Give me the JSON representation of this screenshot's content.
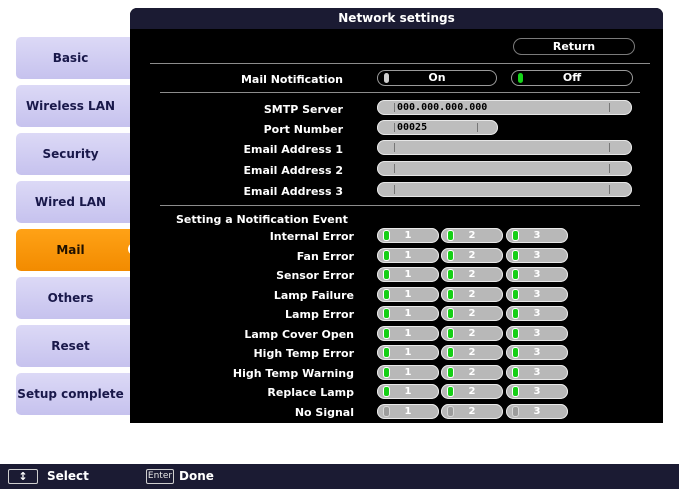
{
  "window": {
    "title": "Network settings"
  },
  "sidebar": {
    "items": [
      {
        "label": "Basic"
      },
      {
        "label": "Wireless LAN"
      },
      {
        "label": "Security"
      },
      {
        "label": "Wired LAN"
      },
      {
        "label": "Mail",
        "active": true
      },
      {
        "label": "Others"
      },
      {
        "label": "Reset"
      },
      {
        "label": "Setup complete"
      }
    ],
    "active_color": "#f28b00",
    "inactive_color": "#d0cdf2"
  },
  "return_label": "Return",
  "mail_notification": {
    "label": "Mail Notification",
    "on_label": "On",
    "off_label": "Off",
    "selected": "Off"
  },
  "smtp": {
    "server_label": "SMTP Server",
    "server_value": "000.000.000.000",
    "port_label": "Port Number",
    "port_value": "00025"
  },
  "email": {
    "address1_label": "Email Address 1",
    "address1_value": "",
    "address2_label": "Email Address 2",
    "address2_value": "",
    "address3_label": "Email Address 3",
    "address3_value": ""
  },
  "events": {
    "heading": "Setting a Notification Event",
    "slot_labels": [
      "1",
      "2",
      "3"
    ],
    "rows": [
      {
        "label": "Internal Error",
        "checked": [
          true,
          true,
          true
        ]
      },
      {
        "label": "Fan Error",
        "checked": [
          true,
          true,
          true
        ]
      },
      {
        "label": "Sensor Error",
        "checked": [
          true,
          true,
          true
        ]
      },
      {
        "label": "Lamp Failure",
        "checked": [
          true,
          true,
          true
        ]
      },
      {
        "label": "Lamp Error",
        "checked": [
          true,
          true,
          true
        ]
      },
      {
        "label": "Lamp Cover Open",
        "checked": [
          true,
          true,
          true
        ]
      },
      {
        "label": "High Temp Error",
        "checked": [
          true,
          true,
          true
        ]
      },
      {
        "label": "High Temp Warning",
        "checked": [
          true,
          true,
          true
        ]
      },
      {
        "label": "Replace Lamp",
        "checked": [
          true,
          true,
          true
        ]
      },
      {
        "label": "No Signal",
        "checked": [
          false,
          false,
          false
        ]
      }
    ]
  },
  "footer": {
    "select_key": "↕",
    "select_label": "Select",
    "enter_key": "Enter",
    "done_label": "Done"
  }
}
